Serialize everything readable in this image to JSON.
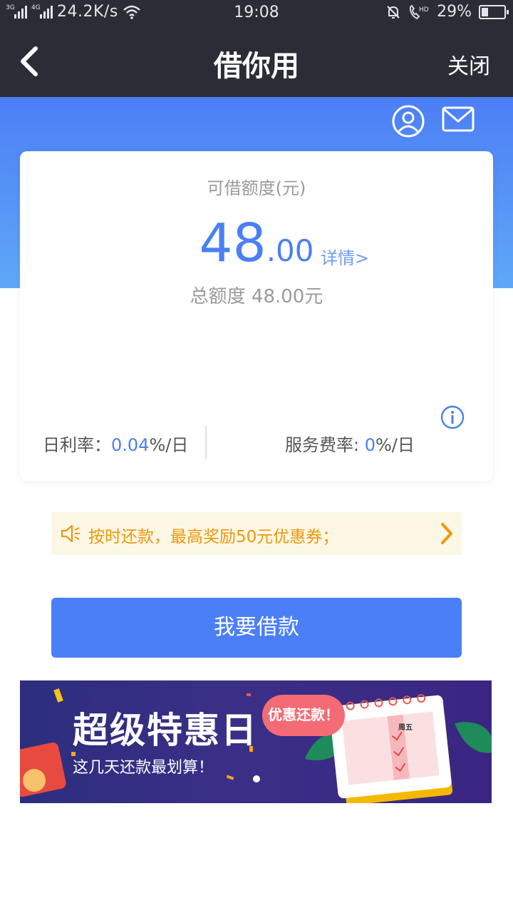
{
  "status_bar": {
    "net1": "3G",
    "net2": "4G",
    "speed": "24.2K/s",
    "time": "19:08",
    "battery_text": "29%",
    "battery_level": 0.29
  },
  "nav": {
    "title": "借你用",
    "close_label": "关闭"
  },
  "card": {
    "available_label": "可借额度(元)",
    "amount_int": "48",
    "amount_dec": ".00",
    "detail_link": "详情>",
    "total_label": "总额度 48.00元",
    "daily_rate_label": "日利率：",
    "daily_rate_value": "0.04",
    "daily_rate_unit": "%/日",
    "service_rate_label": "服务费率: ",
    "service_rate_value": "0",
    "service_rate_unit": "%/日"
  },
  "notice": {
    "text": "按时还款，最高奖励50元优惠券；"
  },
  "borrow_button": "我要借款",
  "banner": {
    "title": "超级特惠日",
    "subtitle": "这几天还款最划算！",
    "tag": "优惠还款！",
    "calendar_label": "周五"
  },
  "colors": {
    "nav_bg": "#2b2d36",
    "accent": "#4a7ff8",
    "notice_text": "#f0960c"
  }
}
